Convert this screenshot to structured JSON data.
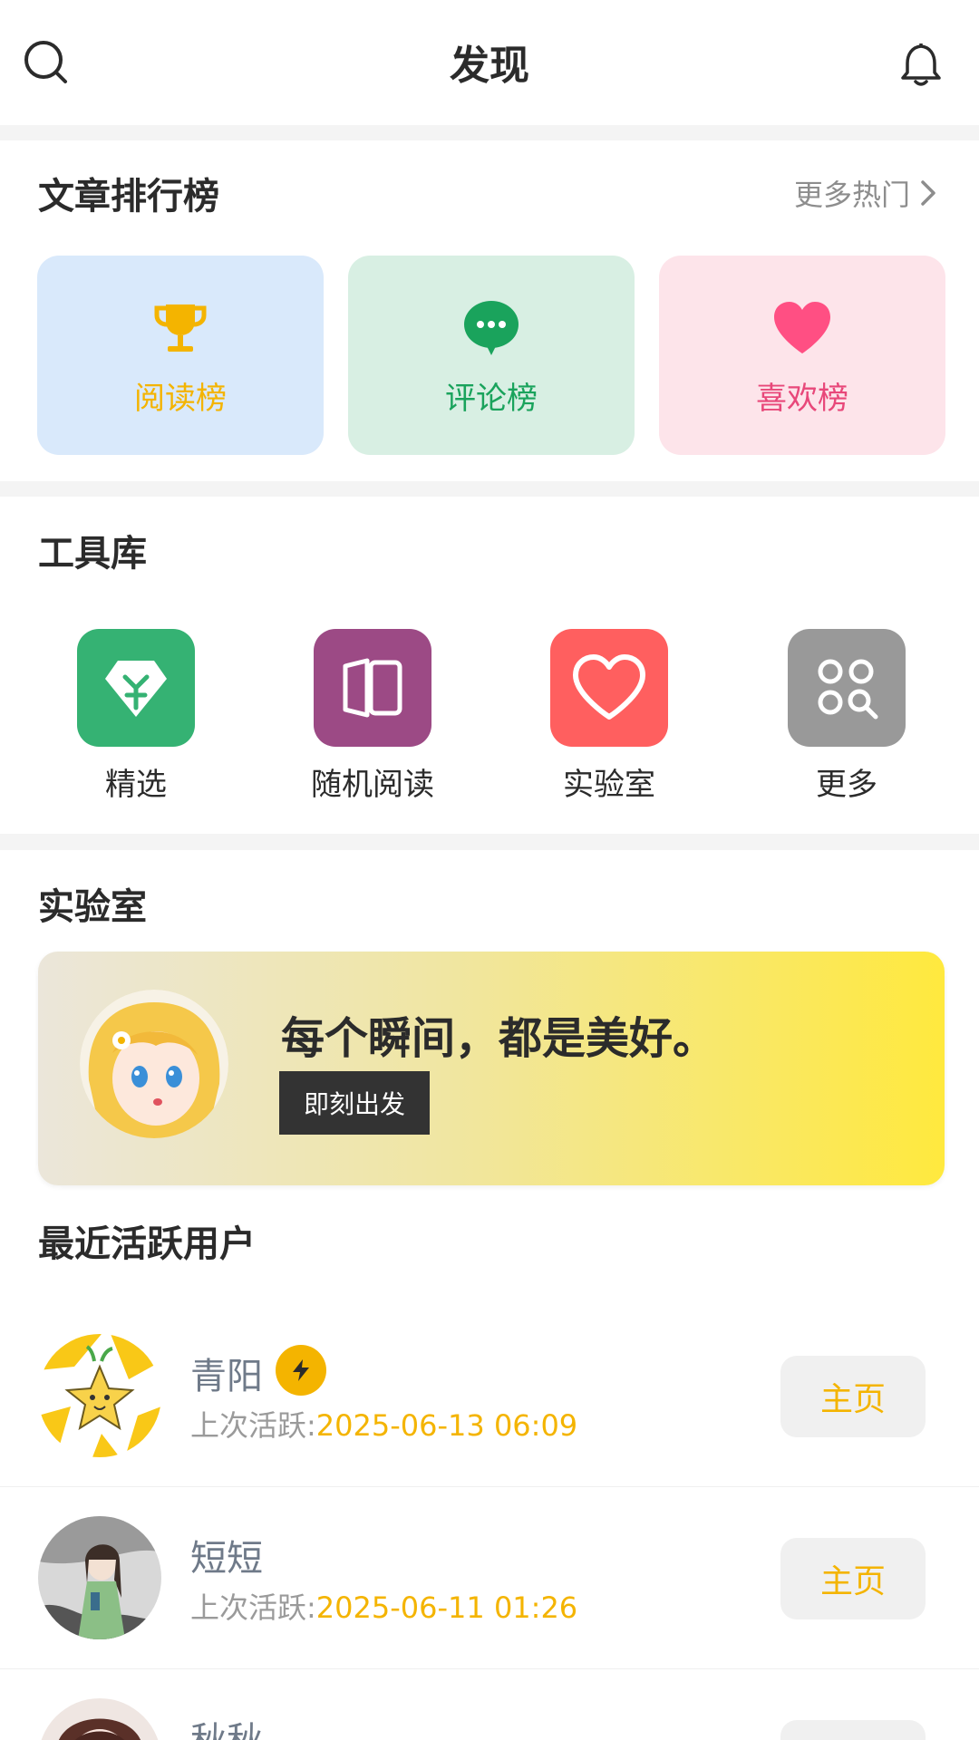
{
  "header": {
    "title": "发现"
  },
  "ranking": {
    "title": "文章排行榜",
    "more_label": "更多热门",
    "cards": [
      {
        "label": "阅读榜",
        "icon": "trophy-icon",
        "bg": "#d9e9fb",
        "color": "#f4b400"
      },
      {
        "label": "评论榜",
        "icon": "chat-bubble-icon",
        "bg": "#d8efe3",
        "color": "#1aa35c"
      },
      {
        "label": "喜欢榜",
        "icon": "heart-icon",
        "bg": "#fde4ea",
        "color": "#e8487a"
      }
    ]
  },
  "tools": {
    "title": "工具库",
    "items": [
      {
        "label": "精选",
        "icon": "diamond-icon",
        "bg": "#35b273"
      },
      {
        "label": "随机阅读",
        "icon": "book-icon",
        "bg": "#9c4a85"
      },
      {
        "label": "实验室",
        "icon": "heart-outline-icon",
        "bg": "#ff5f5f"
      },
      {
        "label": "更多",
        "icon": "grid-search-icon",
        "bg": "#999999"
      }
    ]
  },
  "lab": {
    "title": "实验室",
    "banner_text": "每个瞬间，都是美好。",
    "button_label": "即刻出发"
  },
  "active_users": {
    "title": "最近活跃用户",
    "last_active_prefix": "上次活跃:",
    "home_label": "主页",
    "users": [
      {
        "name": "青阳",
        "time": "2025-06-13 06:09",
        "badge": "lightning-icon"
      },
      {
        "name": "短短",
        "time": "2025-06-11 01:26"
      },
      {
        "name": "秋秋"
      }
    ]
  },
  "colors": {
    "accent": "#f4b400",
    "title": "#2b2b2b"
  }
}
